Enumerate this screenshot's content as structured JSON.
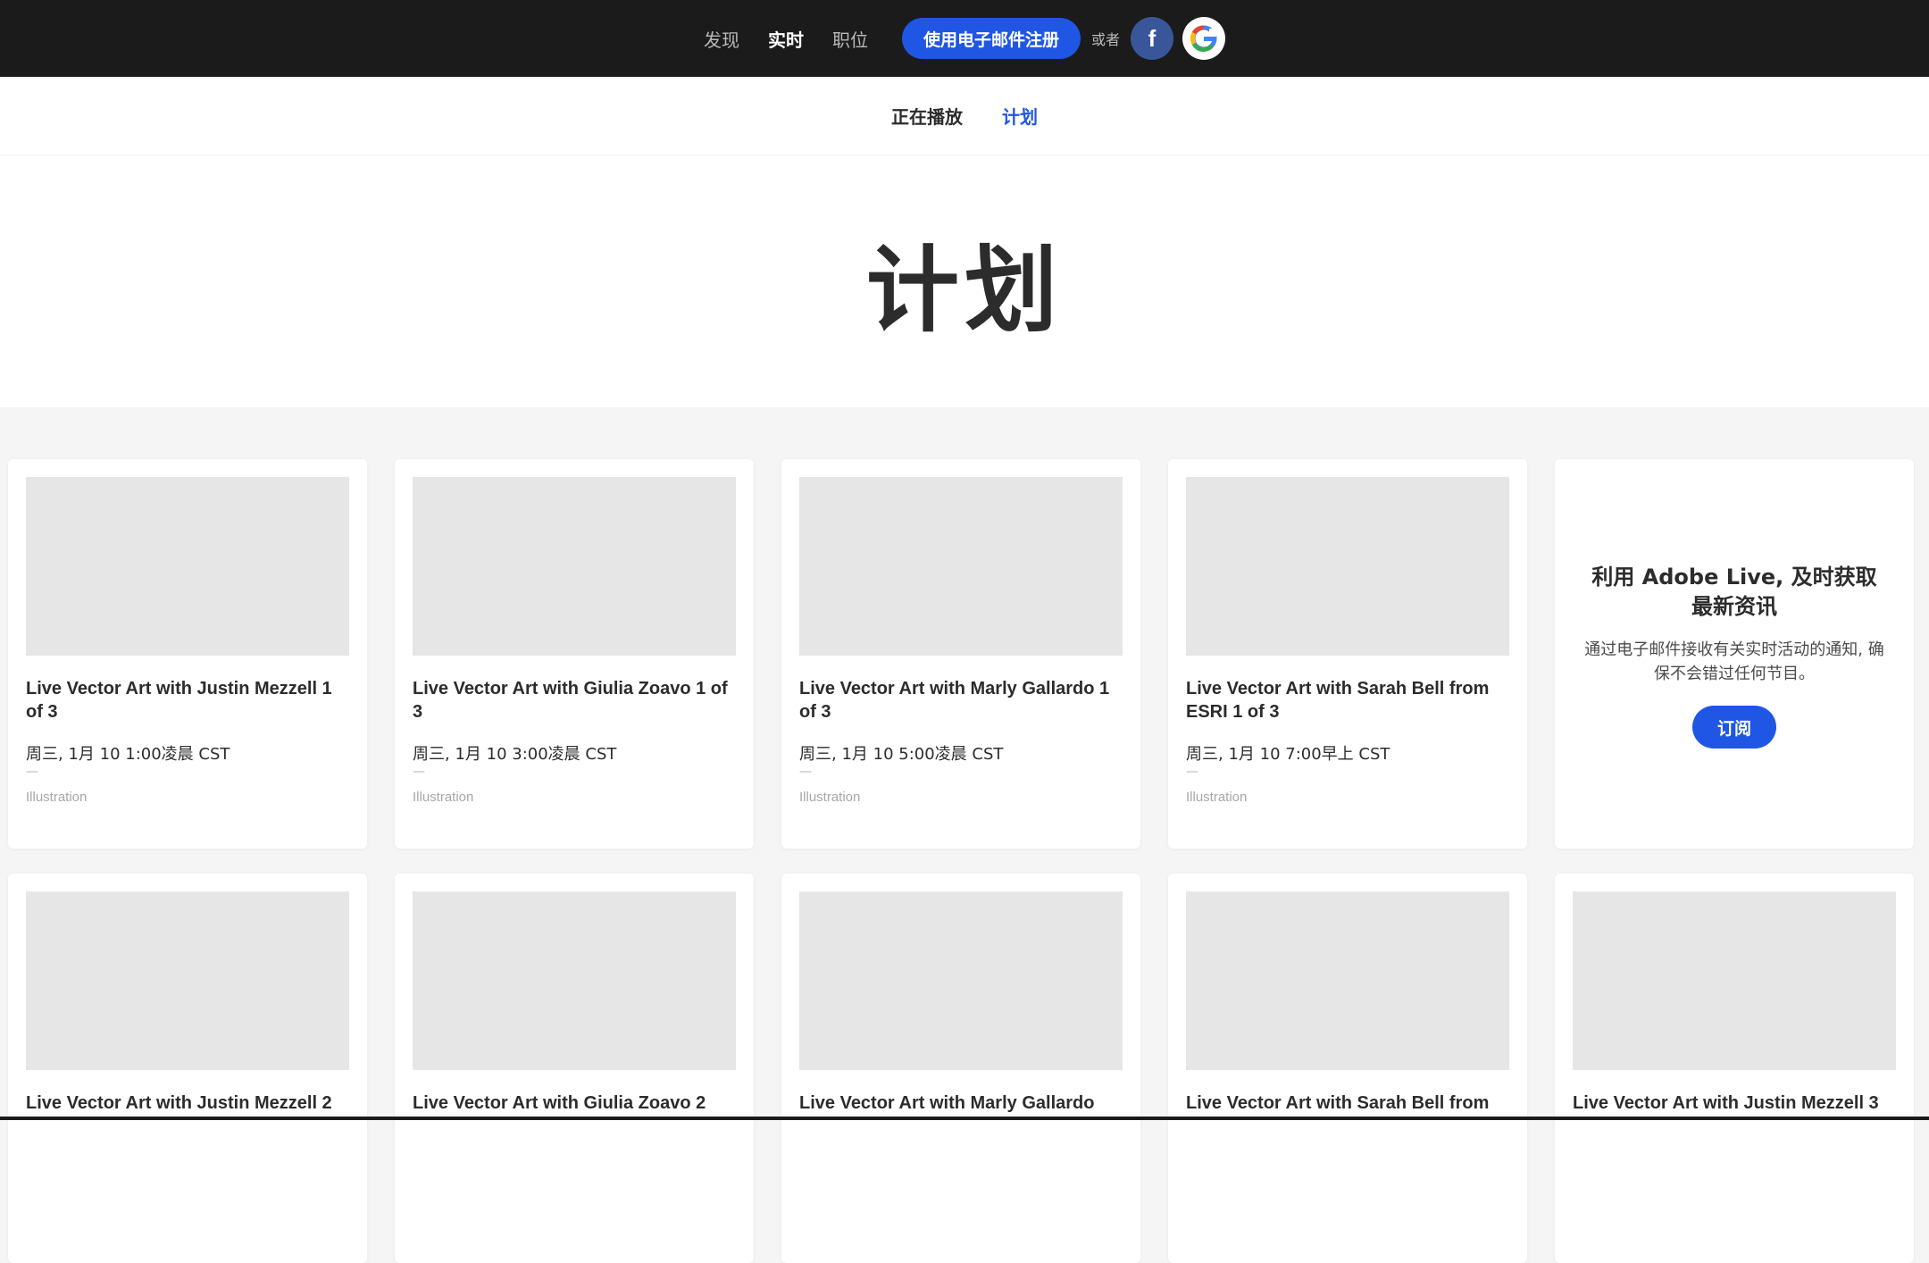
{
  "topbar": {
    "nav": [
      "发现",
      "实时",
      "职位"
    ],
    "active_nav": "实时",
    "signup_label": "使用电子邮件注册",
    "or_label": "或者",
    "facebook_glyph": "f",
    "google_glyph": "G"
  },
  "subtabs": {
    "items": [
      "正在播放",
      "计划"
    ],
    "active": "计划"
  },
  "hero": {
    "title": "计划"
  },
  "cards_row1": [
    {
      "title": "Live Vector Art with Justin Mezzell 1 of 3",
      "date": "周三, 1月 10 1:00凌晨 CST",
      "dash": "—",
      "tag": "Illustration"
    },
    {
      "title": "Live Vector Art with Giulia Zoavo 1 of 3",
      "date": "周三, 1月 10 3:00凌晨 CST",
      "dash": "—",
      "tag": "Illustration"
    },
    {
      "title": "Live Vector Art with Marly Gallardo 1 of 3",
      "date": "周三, 1月 10 5:00凌晨 CST",
      "dash": "—",
      "tag": "Illustration"
    },
    {
      "title": "Live Vector Art with Sarah Bell from ESRI 1 of 3",
      "date": "周三, 1月 10 7:00早上 CST",
      "dash": "—",
      "tag": "Illustration"
    }
  ],
  "promo": {
    "title": "利用 Adobe Live, 及时获取最新资讯",
    "text": "通过电子邮件接收有关实时活动的通知, 确保不会错过任何节目。",
    "button": "订阅"
  },
  "cards_row2": [
    {
      "title": "Live Vector Art with Justin Mezzell 2"
    },
    {
      "title": "Live Vector Art with Giulia Zoavo 2"
    },
    {
      "title": "Live Vector Art with Marly Gallardo"
    },
    {
      "title": "Live Vector Art with Sarah Bell from"
    },
    {
      "title": "Live Vector Art with Justin Mezzell 3"
    }
  ],
  "colors": {
    "accent": "#1f56e4",
    "topbar": "#1b1b1b",
    "facebook": "#3a569b"
  }
}
